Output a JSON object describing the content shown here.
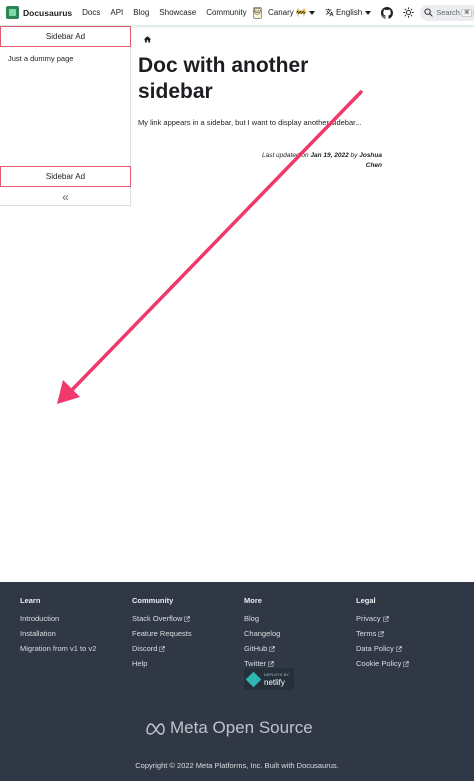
{
  "navbar": {
    "brand": "Docusaurus",
    "links": [
      "Docs",
      "API",
      "Blog",
      "Showcase",
      "Community"
    ],
    "canary_badge": "🐱",
    "version": "Canary 🚧",
    "language": "English",
    "search": {
      "placeholder": "Search",
      "key1": "⌘",
      "key2": "K"
    }
  },
  "sidebar": {
    "ad_top": "Sidebar Ad",
    "link": "Just a dummy page",
    "ad_bottom": "Sidebar Ad",
    "collapse": "«"
  },
  "doc": {
    "title": "Doc with another sidebar",
    "body": "My link appears in a sidebar, but I want to display another sidebar...",
    "last_updated_prefix": "Last updated",
    "last_updated_on": "on",
    "date": "Jan 19, 2022",
    "by": "by",
    "author": "Joshua Chen"
  },
  "annotation": {
    "arrow_color": "#f0386b"
  },
  "footer": {
    "columns": [
      {
        "title": "Learn",
        "items": [
          {
            "label": "Introduction",
            "external": false
          },
          {
            "label": "Installation",
            "external": false
          },
          {
            "label": "Migration from v1 to v2",
            "external": false
          }
        ]
      },
      {
        "title": "Community",
        "items": [
          {
            "label": "Stack Overflow",
            "external": true
          },
          {
            "label": "Feature Requests",
            "external": false
          },
          {
            "label": "Discord",
            "external": true
          },
          {
            "label": "Help",
            "external": false
          }
        ]
      },
      {
        "title": "More",
        "items": [
          {
            "label": "Blog",
            "external": false
          },
          {
            "label": "Changelog",
            "external": false
          },
          {
            "label": "GitHub",
            "external": true
          },
          {
            "label": "Twitter",
            "external": true
          }
        ]
      },
      {
        "title": "Legal",
        "items": [
          {
            "label": "Privacy",
            "external": true
          },
          {
            "label": "Terms",
            "external": true
          },
          {
            "label": "Data Policy",
            "external": true
          },
          {
            "label": "Cookie Policy",
            "external": true
          }
        ]
      }
    ],
    "netlify_small": "DEPLOYS BY",
    "netlify_big": "netlify",
    "meta_logo": "Meta Open Source",
    "copyright": "Copyright © 2022 Meta Platforms, Inc. Built with Docusaurus."
  }
}
